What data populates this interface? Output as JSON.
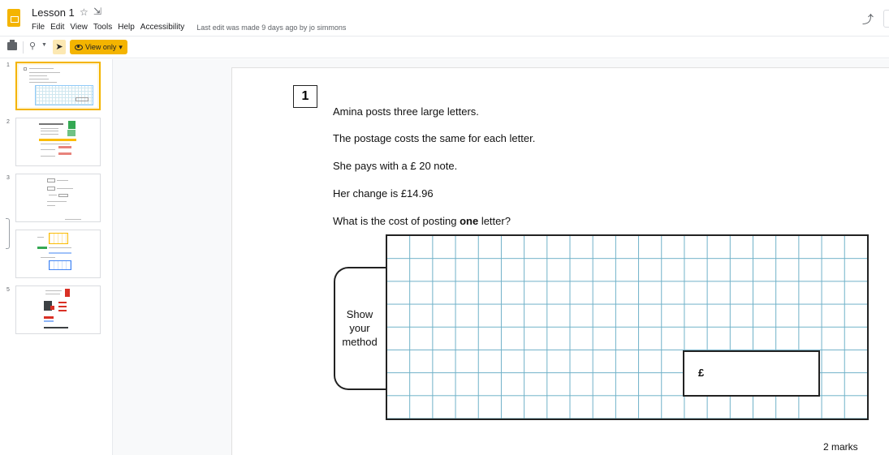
{
  "header": {
    "title": "Lesson 1",
    "star_icon": "star-outline-icon",
    "move_icon": "move-to-folder-icon",
    "menu": [
      "File",
      "Edit",
      "View",
      "Tools",
      "Help",
      "Accessibility"
    ],
    "last_edit": "Last edit was made 9 days ago by jo simmons",
    "activity_icon": "activity-trend-icon"
  },
  "toolbar": {
    "print_icon": "print-icon",
    "zoom_icon": "zoom-icon",
    "select_icon": "select-pointer-icon",
    "view_only_label": "View only",
    "view_only_icon": "eye-icon",
    "caret": "▾"
  },
  "filmstrip": {
    "slides": [
      {
        "number": "1",
        "selected": true
      },
      {
        "number": "2",
        "selected": false
      },
      {
        "number": "3",
        "selected": false
      },
      {
        "number": "4",
        "selected": false
      },
      {
        "number": "5",
        "selected": false
      }
    ]
  },
  "slide": {
    "question_number": "1",
    "lines": [
      "Amina posts three large letters.",
      "The postage costs the same for each letter.",
      "She pays with a £ 20 note.",
      "Her change is £14.96"
    ],
    "question_pre": "What is the cost of posting ",
    "question_bold": "one",
    "question_post": " letter?",
    "method_label": "Show your method",
    "answer_prefix": "£",
    "marks": "2 marks"
  },
  "colors": {
    "accent": "#f4b400",
    "grid_line": "#6fb1c8"
  }
}
